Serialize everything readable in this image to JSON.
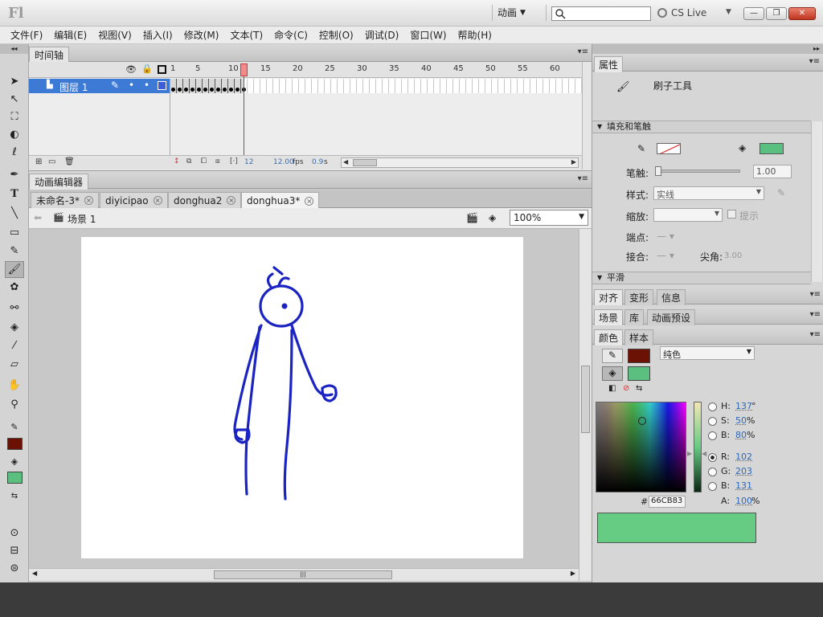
{
  "app": {
    "logo": "Fl",
    "workspace": "动画",
    "cs_live": "CS Live",
    "window_buttons": [
      "—",
      "❐",
      "✕"
    ]
  },
  "menu": [
    "文件(F)",
    "编辑(E)",
    "视图(V)",
    "插入(I)",
    "修改(M)",
    "文本(T)",
    "命令(C)",
    "控制(O)",
    "调试(D)",
    "窗口(W)",
    "帮助(H)"
  ],
  "timeline": {
    "tab": "时间轴",
    "ruler": [
      "1",
      "5",
      "10",
      "15",
      "20",
      "25",
      "30",
      "35",
      "40",
      "45",
      "50",
      "55",
      "60"
    ],
    "layer_name": "图层 1",
    "current_frame": "12",
    "fps": "12.00",
    "fps_unit": "fps",
    "elapsed": "0.9",
    "elapsed_unit": "s"
  },
  "editor": {
    "tab": "动画编辑器",
    "documents": [
      {
        "name": "未命名-3*",
        "active": false
      },
      {
        "name": "diyicipao",
        "active": false
      },
      {
        "name": "donghua2",
        "active": false
      },
      {
        "name": "donghua3*",
        "active": true
      }
    ],
    "scene": "场景 1",
    "zoom": "100%",
    "stroke_color": "#1b24c2"
  },
  "properties": {
    "tab": "属性",
    "tool_name": "刷子工具",
    "section_fill_stroke": "填充和笔触",
    "stroke_label": "笔触:",
    "stroke_value": "1.00",
    "style_label": "样式:",
    "style_value": "实线",
    "scale_label": "缩放:",
    "hint_label": "提示",
    "cap_label": "端点:",
    "join_label": "接合:",
    "miter_label": "尖角:",
    "miter_value": "3.00",
    "section_smooth": "平滑",
    "fill_color": "#5bbf7f"
  },
  "panels": {
    "row1": [
      "对齐",
      "变形",
      "信息"
    ],
    "row2": [
      "场景",
      "库",
      "动画预设"
    ],
    "color_tabs": [
      "颜色",
      "样本"
    ]
  },
  "color": {
    "stroke_swatch": "#6b1205",
    "fill_swatch": "#5bbf7f",
    "type": "纯色",
    "H_label": "H:",
    "H": "137",
    "H_unit": "°",
    "S_label": "S:",
    "S": "50",
    "S_unit": "%",
    "B_label": "B:",
    "B": "80",
    "B_unit": "%",
    "R_label": "R:",
    "R": "102",
    "G_label": "G:",
    "G": "203",
    "Bv_label": "B:",
    "Bv": "131",
    "A_label": "A:",
    "A": "100",
    "A_unit": "%",
    "hash": "#",
    "hex": "66CB83",
    "preview": "#66cb83"
  },
  "toolbar": {
    "stroke_color": "#6b1205",
    "fill_color": "#5bbf7f"
  }
}
